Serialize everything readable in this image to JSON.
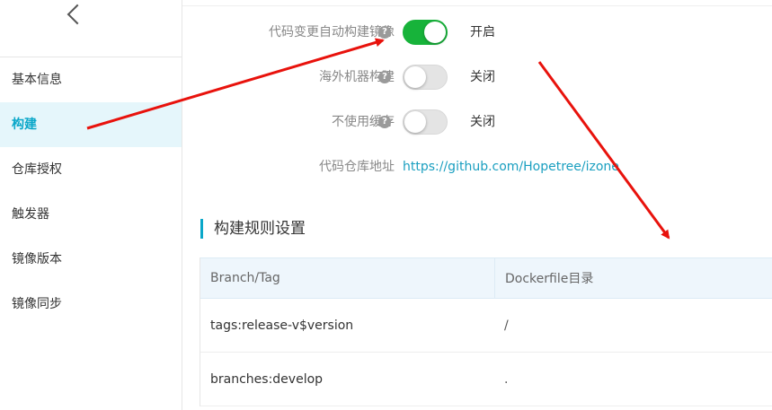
{
  "sidebar": {
    "back_label": "",
    "items": [
      {
        "label": "基本信息"
      },
      {
        "label": "构建"
      },
      {
        "label": "仓库授权"
      },
      {
        "label": "触发器"
      },
      {
        "label": "镜像版本"
      },
      {
        "label": "镜像同步"
      }
    ],
    "active_index": 1
  },
  "settings": {
    "auto_build": {
      "label": "代码变更自动构建镜像",
      "help": "?",
      "enabled": true,
      "state": "开启"
    },
    "overseas": {
      "label": "海外机器构建",
      "help": "?",
      "enabled": false,
      "state": "关闭"
    },
    "no_cache": {
      "label": "不使用缓存",
      "help": "?",
      "enabled": false,
      "state": "关闭"
    },
    "repo": {
      "label": "代码仓库地址",
      "url": "https://github.com/Hopetree/izone"
    }
  },
  "rules": {
    "title": "构建规则设置",
    "columns": [
      "Branch/Tag",
      "Dockerfile目录"
    ],
    "rows": [
      {
        "branch": "tags:release-v$version",
        "dir": "/"
      },
      {
        "branch": "branches:develop",
        "dir": "."
      }
    ]
  },
  "colors": {
    "accent": "#0aa7c9",
    "toggle_on": "#17b33a",
    "annotation": "#e8120c"
  }
}
